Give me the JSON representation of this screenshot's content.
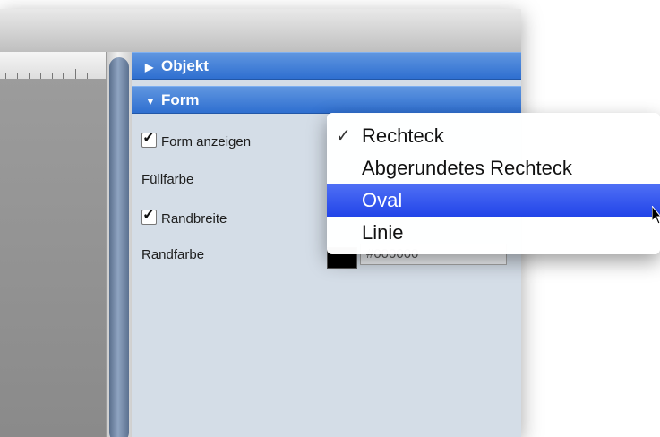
{
  "sections": {
    "objekt": {
      "label": "Objekt",
      "collapsed": true
    },
    "form": {
      "label": "Form",
      "collapsed": false
    }
  },
  "form_panel": {
    "show_shape": {
      "label": "Form anzeigen",
      "checked": true
    },
    "fill_color": {
      "label": "Füllfarbe"
    },
    "border_width": {
      "label": "Randbreite",
      "checked": true
    },
    "border_color": {
      "label": "Randfarbe",
      "swatch": "#000000",
      "hex_value": "#000000"
    }
  },
  "shape_menu": {
    "items": [
      {
        "label": "Rechteck",
        "checked": true,
        "selected": false
      },
      {
        "label": "Abgerundetes Rechteck",
        "checked": false,
        "selected": false
      },
      {
        "label": "Oval",
        "checked": false,
        "selected": true
      },
      {
        "label": "Linie",
        "checked": false,
        "selected": false
      }
    ],
    "check_glyph": "✓",
    "highlight_color": "#3158ee"
  },
  "colors": {
    "section_header": "#3a78d6",
    "panel_background": "#d4dde7"
  }
}
